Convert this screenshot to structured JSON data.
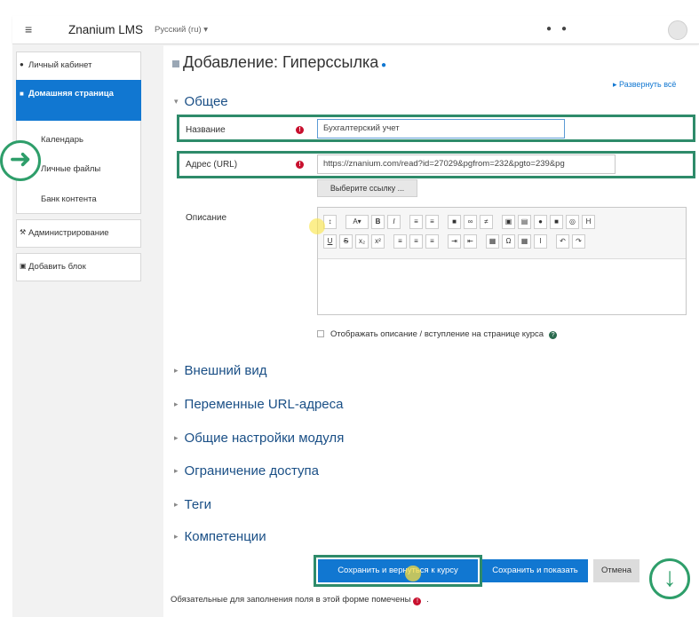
{
  "navbar": {
    "brand": "Znanium LMS",
    "language": "Русский (ru) ▾",
    "icons": [
      "menu-icon",
      "bell-icon",
      "chat-icon",
      "avatar",
      "chevron-down-icon"
    ]
  },
  "sidebar": {
    "items": [
      {
        "label": "Личный кабинет",
        "icon": "dashboard-icon"
      },
      {
        "label": "Домашняя страница",
        "icon": "home-icon",
        "active": true
      },
      {
        "label": "Календарь",
        "icon": "calendar-icon"
      },
      {
        "label": "Личные файлы",
        "icon": "file-icon"
      },
      {
        "label": "Банк контента",
        "icon": "cube-icon"
      },
      {
        "label": "Администрирование",
        "icon": "wrench-icon"
      },
      {
        "label": "Добавить блок",
        "icon": "plus-square-icon"
      }
    ]
  },
  "page": {
    "title": "Добавление: Гиперссылка",
    "expand_all": "▸ Развернуть всё",
    "section_general": "Общее"
  },
  "form": {
    "name_label": "Название",
    "name_value": "Бухгалтерский учет",
    "url_label": "Адрес (URL)",
    "url_value": "https://znanium.com/read?id=27029&pgfrom=232&pgto=239&pg",
    "choose_link": "Выберите ссылку ...",
    "description_label": "Описание",
    "show_description": "Отображать описание / вступление на странице курса"
  },
  "collapsed_sections": [
    "Внешний вид",
    "Переменные URL-адреса",
    "Общие настройки модуля",
    "Ограничение доступа",
    "Теги",
    "Компетенции"
  ],
  "buttons": {
    "save_return": "Сохранить и вернуться к курсу",
    "save_show": "Сохранить и показать",
    "cancel": "Отмена"
  },
  "footnote": "Обязательные для заполнения поля в этой форме помечены",
  "colors": {
    "accent": "#1177d1",
    "highlight": "#2e8b6a",
    "required": "#c8102e"
  }
}
